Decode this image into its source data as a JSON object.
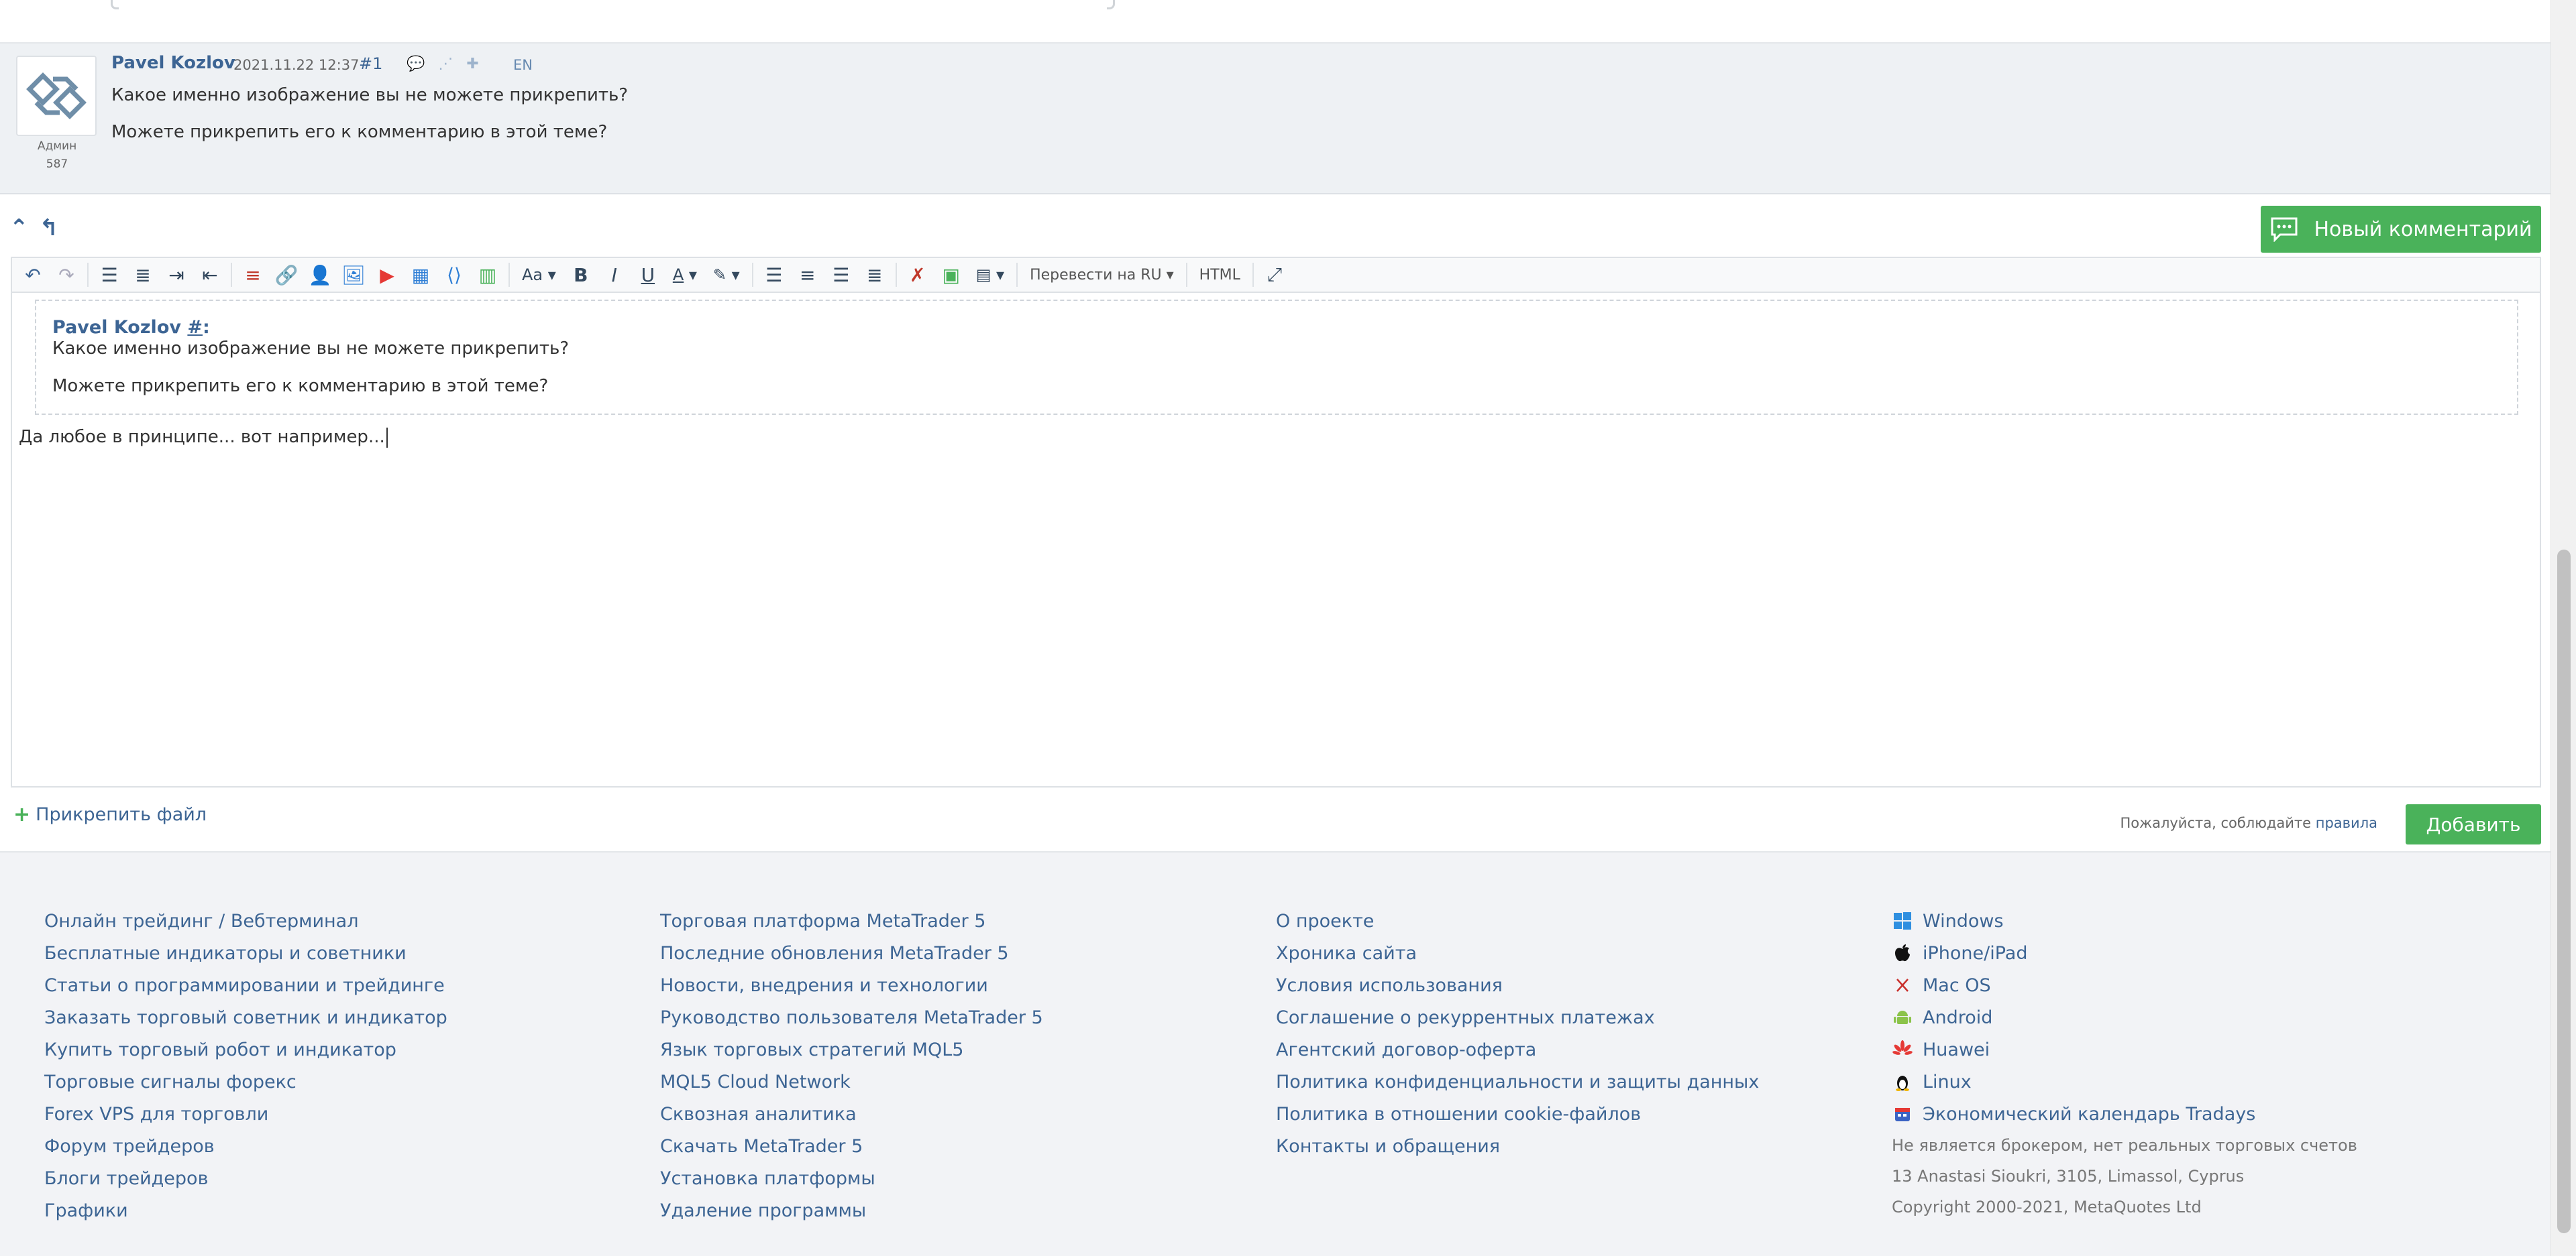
{
  "comment": {
    "author": "Pavel Kozlov",
    "date": "2021.11.22 12:37",
    "number": "#1",
    "lang": "EN",
    "role": "Админ",
    "rating": "587",
    "lines": [
      "Какое именно изображение вы не можете прикрепить?",
      "Можете прикрепить его к комментарию в этой теме?"
    ]
  },
  "nav": {
    "up_icon": "double-chevron-up-icon",
    "back_icon": "arrow-up-left-icon"
  },
  "new_comment_button": "Новый комментарий",
  "toolbar": {
    "font_size": "Aa",
    "bold": "B",
    "italic": "I",
    "underline": "U",
    "font_color": "A",
    "translate": "Перевести на RU",
    "html": "HTML"
  },
  "editor": {
    "quote_author": "Pavel Kozlov",
    "quote_hash": "#",
    "quote_colon": ":",
    "quote_lines": [
      "Какое именно изображение вы не можете прикрепить?",
      "Можете прикрепить его к комментарию в этой теме?"
    ],
    "reply_text": "Да любое в принципе... вот например..."
  },
  "attach_label": "Прикрепить файл",
  "rules_note_prefix": "Пожалуйста, соблюдайте ",
  "rules_link": "правила",
  "add_button": "Добавить",
  "footer": {
    "col1": [
      "Онлайн трейдинг / Вебтерминал",
      "Бесплатные индикаторы и советники",
      "Статьи о программировании и трейдинге",
      "Заказать торговый советник и индикатор",
      "Купить торговый робот и индикатор",
      "Торговые сигналы форекс",
      "Forex VPS для торговли",
      "Форум трейдеров",
      "Блоги трейдеров",
      "Графики"
    ],
    "col2": [
      "Торговая платформа MetaTrader 5",
      "Последние обновления MetaTrader 5",
      "Новости, внедрения и технологии",
      "Руководство пользователя MetaTrader 5",
      "Язык торговых стратегий MQL5",
      "MQL5 Cloud Network",
      "Сквозная аналитика",
      "Скачать MetaTrader 5",
      "Установка платформы",
      "Удаление программы"
    ],
    "col3": [
      "О проекте",
      "Хроника сайта",
      "Условия использования",
      "Соглашение о рекуррентных платежах",
      "Агентский договор-оферта",
      "Политика конфиденциальности и защиты данных",
      "Политика в отношении cookie-файлов",
      "Контакты и обращения"
    ],
    "col4": [
      {
        "label": "Windows",
        "icon": "windows-icon"
      },
      {
        "label": "iPhone/iPad",
        "icon": "apple-icon"
      },
      {
        "label": "Mac OS",
        "icon": "macos-icon"
      },
      {
        "label": "Android",
        "icon": "android-icon"
      },
      {
        "label": "Huawei",
        "icon": "huawei-icon"
      },
      {
        "label": "Linux",
        "icon": "linux-icon"
      },
      {
        "label": "Экономический календарь Tradays",
        "icon": "tradays-icon"
      }
    ],
    "info": [
      "Не является брокером, нет реальных торговых счетов",
      "13 Anastasi Sioukri, 3105, Limassol, Cyprus",
      "Copyright 2000-2021, MetaQuotes Ltd"
    ]
  },
  "colors": {
    "link": "#3d6594",
    "accent_green": "#4ab25a",
    "comment_bg": "#eef1f4"
  }
}
